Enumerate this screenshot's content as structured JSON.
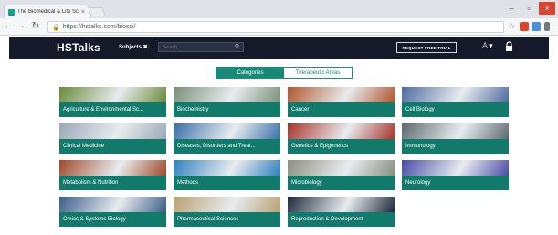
{
  "browser": {
    "tab_title": "The Biomedical & Life Sci",
    "tab_close": "×",
    "url_secure": "https://",
    "url_rest": "hstalks.com/biosci/",
    "window_min": "–",
    "window_max": "▫",
    "window_close": "×"
  },
  "header": {
    "logo": "HSTalks",
    "subjects_label": "Subjects ✖",
    "search_placeholder": "Search",
    "trial_button": "REQUEST FREE TRIAL"
  },
  "toggle": {
    "active": "Categories",
    "inactive": "Therapeutic Areas"
  },
  "categories": [
    {
      "label": "Agriculture & Environmental Sc...",
      "color": "#6b8a3a"
    },
    {
      "label": "Biochemistry",
      "color": "#7a8f78"
    },
    {
      "label": "Cancer",
      "color": "#b0562c"
    },
    {
      "label": "Cell Biology",
      "color": "#4d6aa0"
    },
    {
      "label": "Clinical Medicine",
      "color": "#9aa8b8"
    },
    {
      "label": "Diseases, Disorders and Treat...",
      "color": "#3a6fa8"
    },
    {
      "label": "Genetics & Epigenetics",
      "color": "#a8342a"
    },
    {
      "label": "Immunology",
      "color": "#5e6a70"
    },
    {
      "label": "Metabolism & Nutrition",
      "color": "#a04a2a"
    },
    {
      "label": "Methods",
      "color": "#2f7fbf"
    },
    {
      "label": "Microbiology",
      "color": "#8a8f80"
    },
    {
      "label": "Neurology",
      "color": "#4a4aa8"
    },
    {
      "label": "Omics & Systems Biology",
      "color": "#3c5e88"
    },
    {
      "label": "Pharmaceutical Sciences",
      "color": "#b8a070"
    },
    {
      "label": "Reproduction & Development",
      "color": "#1d2a3a"
    }
  ]
}
